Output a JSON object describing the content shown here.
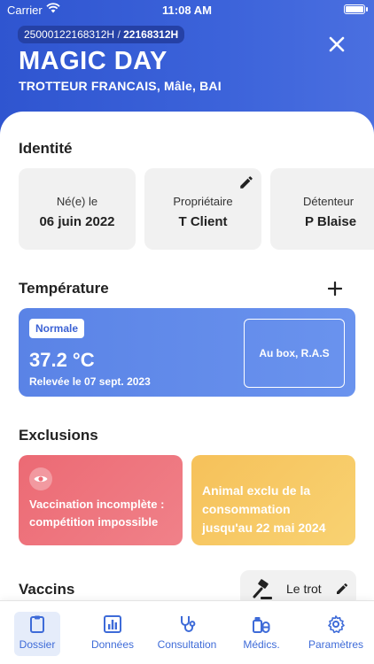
{
  "status_bar": {
    "carrier": "Carrier",
    "time": "11:08 AM"
  },
  "header": {
    "id_primary": "25000122168312H",
    "id_separator": " / ",
    "id_secondary": "22168312H",
    "name": "MAGIC DAY",
    "subtitle": "TROTTEUR FRANCAIS, Mâle, BAI",
    "close_icon": "close-icon"
  },
  "identity": {
    "title": "Identité",
    "cards": [
      {
        "label": "Né(e) le",
        "value": "06 juin 2022"
      },
      {
        "label": "Propriétaire",
        "value": "T Client",
        "editable": true
      },
      {
        "label": "Détenteur",
        "value": "P Blaise"
      }
    ]
  },
  "temperature": {
    "title": "Température",
    "status": "Normale",
    "value": "37.2 °C",
    "date": "Relevée le 07 sept. 2023",
    "note": "Au box, R.A.S",
    "color": "#5a83e6"
  },
  "exclusions": {
    "title": "Exclusions",
    "items": [
      {
        "text_line1": "Vaccination incomplète :",
        "text_line2": "compétition impossible",
        "color": "#ec6a74",
        "icon": "eye-icon"
      },
      {
        "text_line1": "Animal exclu de la",
        "text_line2": "consommation",
        "text_line3": "jusqu'au 22 mai 2024",
        "color": "#f6c15a"
      }
    ]
  },
  "vaccins": {
    "title": "Vaccins",
    "filter_label": "Le trot",
    "filter_icon": "gavel-icon"
  },
  "tabbar": {
    "accent": "#3e6bd8",
    "tabs": [
      {
        "label": "Dossier",
        "icon": "clipboard-icon",
        "active": true
      },
      {
        "label": "Données",
        "icon": "bar-chart-icon"
      },
      {
        "label": "Consultation",
        "icon": "stethoscope-icon"
      },
      {
        "label": "Médics.",
        "icon": "medicine-icon"
      },
      {
        "label": "Paramètres",
        "icon": "gear-icon"
      }
    ]
  }
}
